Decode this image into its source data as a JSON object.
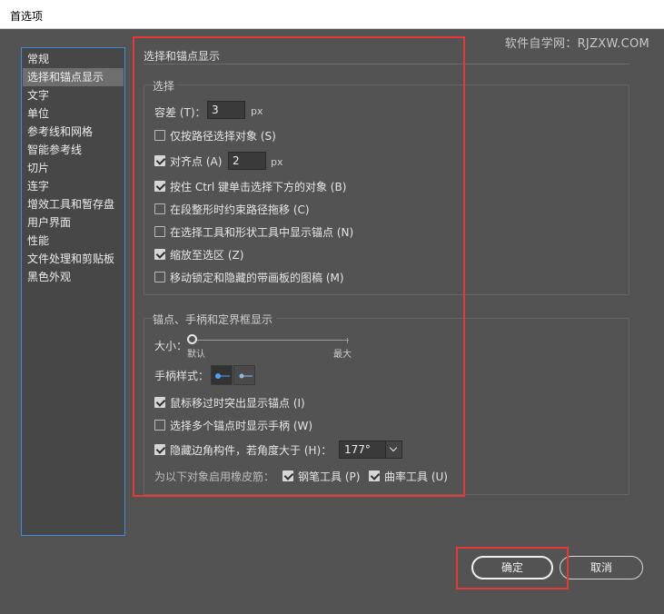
{
  "window": {
    "title": "首选项"
  },
  "watermark": "软件自学网：RJZXW.COM",
  "sidebar": {
    "items": [
      {
        "label": "常规"
      },
      {
        "label": "选择和锚点显示"
      },
      {
        "label": "文字"
      },
      {
        "label": "单位"
      },
      {
        "label": "参考线和网格"
      },
      {
        "label": "智能参考线"
      },
      {
        "label": "切片"
      },
      {
        "label": "连字"
      },
      {
        "label": "增效工具和暂存盘"
      },
      {
        "label": "用户界面"
      },
      {
        "label": "性能"
      },
      {
        "label": "文件处理和剪贴板"
      },
      {
        "label": "黑色外观"
      }
    ],
    "selected_index": 1
  },
  "panel": {
    "title": "选择和锚点显示",
    "selection": {
      "group_label": "选择",
      "tolerance_label": "容差 (T)：",
      "tolerance_value": "3",
      "tolerance_unit": "px",
      "path_only": {
        "label": "仅按路径选择对象 (S)",
        "checked": false
      },
      "snap_to_point": {
        "label": "对齐点 (A)",
        "checked": true
      },
      "snap_value": "2",
      "snap_unit": "px",
      "ctrl_click": {
        "label": "按住 Ctrl 键单击选择下方的对象 (B)",
        "checked": true
      },
      "constrain_path": {
        "label": "在段整形时约束路径拖移 (C)",
        "checked": false
      },
      "show_anchors": {
        "label": "在选择工具和形状工具中显示锚点 (N)",
        "checked": false
      },
      "zoom_to_selection": {
        "label": "缩放至选区 (Z)",
        "checked": true
      },
      "move_locked": {
        "label": "移动锁定和隐藏的带画板的图稿 (M)",
        "checked": false
      }
    },
    "anchor_display": {
      "group_label": "锚点、手柄和定界框显示",
      "size_label": "大小：",
      "size_min": "默认",
      "size_max": "最大",
      "size_level": 0,
      "handle_style_label": "手柄样式：",
      "highlight_on_hover": {
        "label": "鼠标移过时突出显示锚点 (I)",
        "checked": true
      },
      "show_handles_multi": {
        "label": "选择多个锚点时显示手柄 (W)",
        "checked": false
      },
      "hide_corner_widget": {
        "label": "隐藏边角构件，若角度大于 (H)：",
        "checked": true
      },
      "angle_value": "177°",
      "rubber_band_label": "为以下对象启用橡皮筋：",
      "pen_tool": {
        "label": "钢笔工具 (P)",
        "checked": true
      },
      "curvature_tool": {
        "label": "曲率工具 (U)",
        "checked": true
      }
    }
  },
  "buttons": {
    "ok": "确定",
    "cancel": "取消"
  },
  "colors": {
    "panel_bg": "#535353",
    "highlight": "#e53935",
    "sidebar_border": "#3d8de0",
    "handle_blue": "#4aa3ff"
  }
}
